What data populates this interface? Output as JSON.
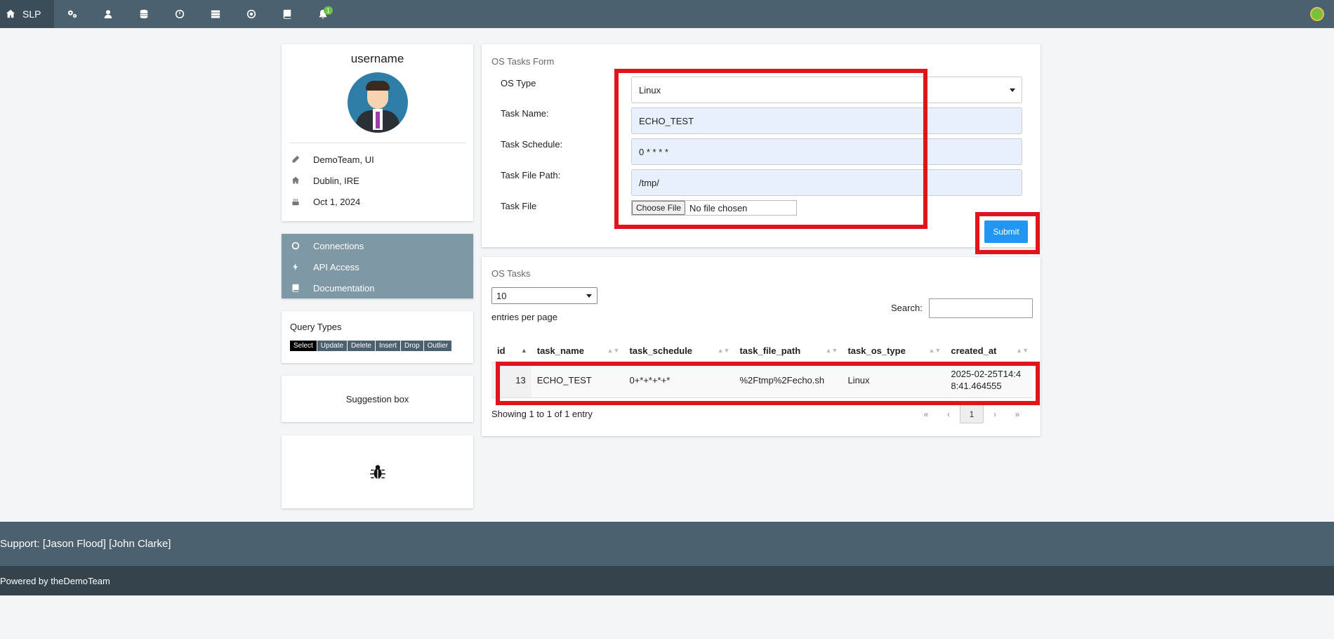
{
  "nav": {
    "brand": "SLP",
    "icons": [
      "cogs-icon",
      "user-icon",
      "database-icon",
      "clock-icon",
      "server-icon",
      "target-icon",
      "book-icon",
      "bell-icon"
    ],
    "notification_count": "1"
  },
  "profile": {
    "username": "username",
    "team": "DemoTeam, UI",
    "location": "Dublin, IRE",
    "date": "Oct 1, 2024"
  },
  "sidemenu": {
    "items": [
      {
        "label": "Connections",
        "icon": "circle-icon"
      },
      {
        "label": "API Access",
        "icon": "bolt-icon"
      },
      {
        "label": "Documentation",
        "icon": "book-icon"
      }
    ]
  },
  "query_types": {
    "title": "Query Types",
    "buttons": [
      "Select",
      "Update",
      "Delete",
      "Insert",
      "Drop",
      "Outlier"
    ]
  },
  "suggestion_box": "Suggestion box",
  "form": {
    "title": "OS Tasks Form",
    "os_type_label": "OS Type",
    "os_type_value": "Linux",
    "task_name_label": "Task Name:",
    "task_name_value": "ECHO_TEST",
    "task_schedule_label": "Task Schedule:",
    "task_schedule_value": "0 * * * *",
    "task_file_path_label": "Task File Path:",
    "task_file_path_value": "/tmp/",
    "task_file_label": "Task File",
    "choose_file": "Choose File",
    "no_file": "No file chosen",
    "submit": "Submit"
  },
  "tasks": {
    "title": "OS Tasks",
    "page_size": "10",
    "entries_per_page": "entries per page",
    "search_label": "Search:",
    "columns": [
      "id",
      "task_name",
      "task_schedule",
      "task_file_path",
      "task_os_type",
      "created_at"
    ],
    "rows": [
      {
        "id": "13",
        "task_name": "ECHO_TEST",
        "task_schedule": "0+*+*+*+*",
        "task_file_path": "%2Ftmp%2Fecho.sh",
        "task_os_type": "Linux",
        "created_at": "2025-02-25T14:48:41.464555"
      }
    ],
    "showing": "Showing 1 to 1 of 1 entry",
    "pager": {
      "first": "«",
      "prev": "‹",
      "current": "1",
      "next": "›",
      "last": "»"
    }
  },
  "footer": {
    "support": "Support: [Jason Flood] [John Clarke]",
    "powered": "Powered by theDemoTeam"
  },
  "colors": {
    "nav": "#4c616f",
    "accent": "#2196f3",
    "highlight": "#e0151c",
    "sidemenu": "#7f98a5"
  }
}
